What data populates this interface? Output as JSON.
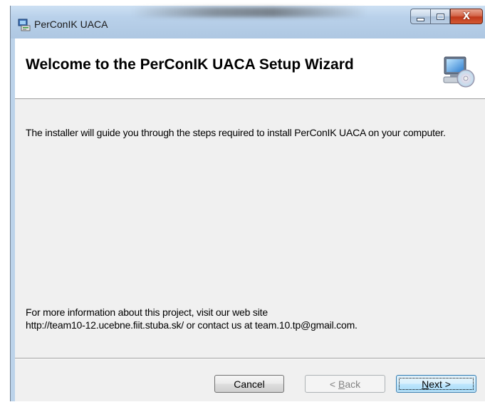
{
  "window": {
    "title": "PerConIK UACA",
    "icon": "installer-icon",
    "controls": {
      "minimize_icon": "minimize-icon",
      "maximize_icon": "maximize-icon",
      "close_icon": "close-icon",
      "close_glyph": "X"
    }
  },
  "banner": {
    "title": "Welcome to the PerConIK UACA Setup Wizard",
    "icon": "computer-cd-icon"
  },
  "content": {
    "intro": "The installer will guide you through the steps required to install PerConIK UACA on your computer.",
    "info_line1": "For more information about this project, visit our web site",
    "info_line2": "http://team10-12.ucebne.fiit.stuba.sk/ or contact us at team.10.tp@gmail.com."
  },
  "buttons": {
    "cancel": {
      "label": "Cancel",
      "enabled": true
    },
    "back": {
      "prefix": "< ",
      "mnemonic": "B",
      "rest": "ack",
      "enabled": false
    },
    "next": {
      "mnemonic": "N",
      "rest": "ext >",
      "enabled": true,
      "default": true
    }
  },
  "colors": {
    "title_bar": "#b9d1ea",
    "client": "#f0f0f0",
    "close_button": "#c0391b",
    "next_button": "#bee6fd"
  }
}
